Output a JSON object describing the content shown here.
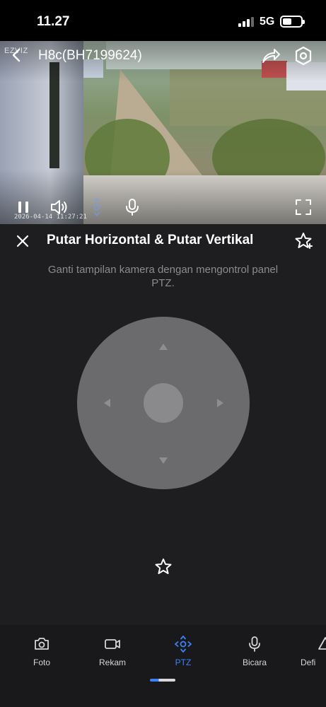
{
  "status_bar": {
    "time": "11.27",
    "network": "5G",
    "battery_level": 0.4
  },
  "video": {
    "watermark": "EZVIZ",
    "camera_title": "H8c(BH7199624)",
    "timestamp": "2026-04-14  11:27:21"
  },
  "panel": {
    "title": "Putar Horizontal & Putar Vertikal",
    "description": "Ganti tampilan kamera dengan mengontrol panel PTZ."
  },
  "tabs": [
    {
      "label": "Foto",
      "icon": "camera-icon",
      "active": false
    },
    {
      "label": "Rekam",
      "icon": "video-record-icon",
      "active": false
    },
    {
      "label": "PTZ",
      "icon": "ptz-icon",
      "active": true
    },
    {
      "label": "Bicara",
      "icon": "microphone-icon",
      "active": false
    },
    {
      "label": "Defi",
      "icon": "definition-icon",
      "active": false
    }
  ],
  "colors": {
    "accent": "#3b82f6",
    "panel_bg": "#1e1e20",
    "joystick": "#6b6b6e"
  }
}
